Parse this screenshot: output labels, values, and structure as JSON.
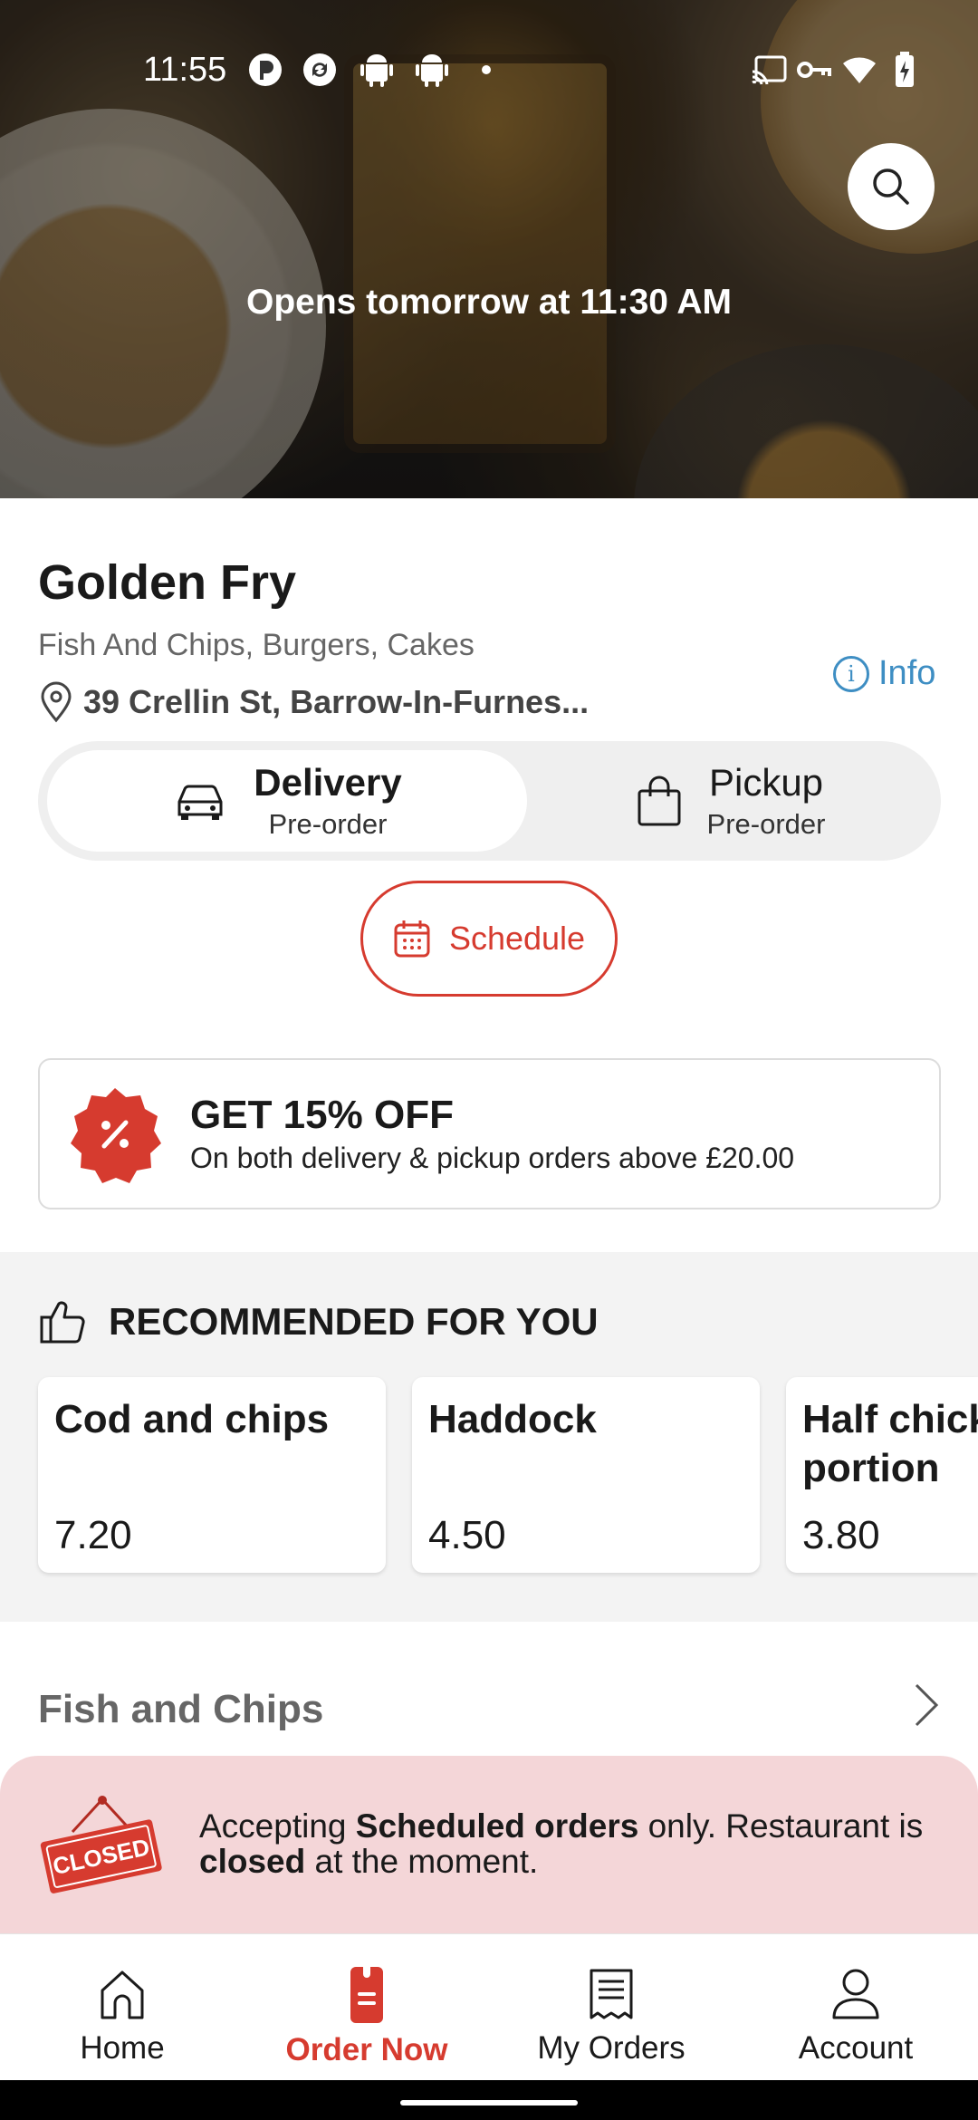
{
  "status_bar": {
    "time": "11:55"
  },
  "hero": {
    "status_message": "Opens tomorrow at 11:30 AM"
  },
  "restaurant": {
    "name": "Golden Fry",
    "cuisine": "Fish And Chips, Burgers, Cakes",
    "address": "39 Crellin St, Barrow-In-Furnes...",
    "info_label": "Info"
  },
  "order_mode": {
    "delivery_label": "Delivery",
    "delivery_sub": "Pre-order",
    "pickup_label": "Pickup",
    "pickup_sub": "Pre-order",
    "selected": "delivery"
  },
  "schedule_label": "Schedule",
  "offer": {
    "title": "GET 15% OFF",
    "subtitle": "On both delivery & pickup orders above £20.00"
  },
  "recommended": {
    "title": "RECOMMENDED FOR YOU",
    "items": [
      {
        "name": "Cod and chips",
        "price": "7.20"
      },
      {
        "name": "Haddock",
        "price": "4.50"
      },
      {
        "name": "Half chicken portion",
        "price": "3.80"
      }
    ]
  },
  "menu_section": {
    "title": "Fish and Chips"
  },
  "closed_banner": {
    "sign_text": "CLOSED",
    "part1": "Accepting ",
    "bold1": "Scheduled orders",
    "part2": " only. Restaurant is ",
    "bold2": "closed",
    "part3": " at the moment."
  },
  "bottom_nav": {
    "items": [
      {
        "label": "Home",
        "icon": "home-icon"
      },
      {
        "label": "Order Now",
        "icon": "order-now-icon"
      },
      {
        "label": "My Orders",
        "icon": "receipt-icon"
      },
      {
        "label": "Account",
        "icon": "person-icon"
      }
    ],
    "active": "Order Now"
  },
  "colors": {
    "accent": "#d63b2f",
    "info_blue": "#3e8ec3",
    "banner_bg": "#f4d6d8"
  }
}
